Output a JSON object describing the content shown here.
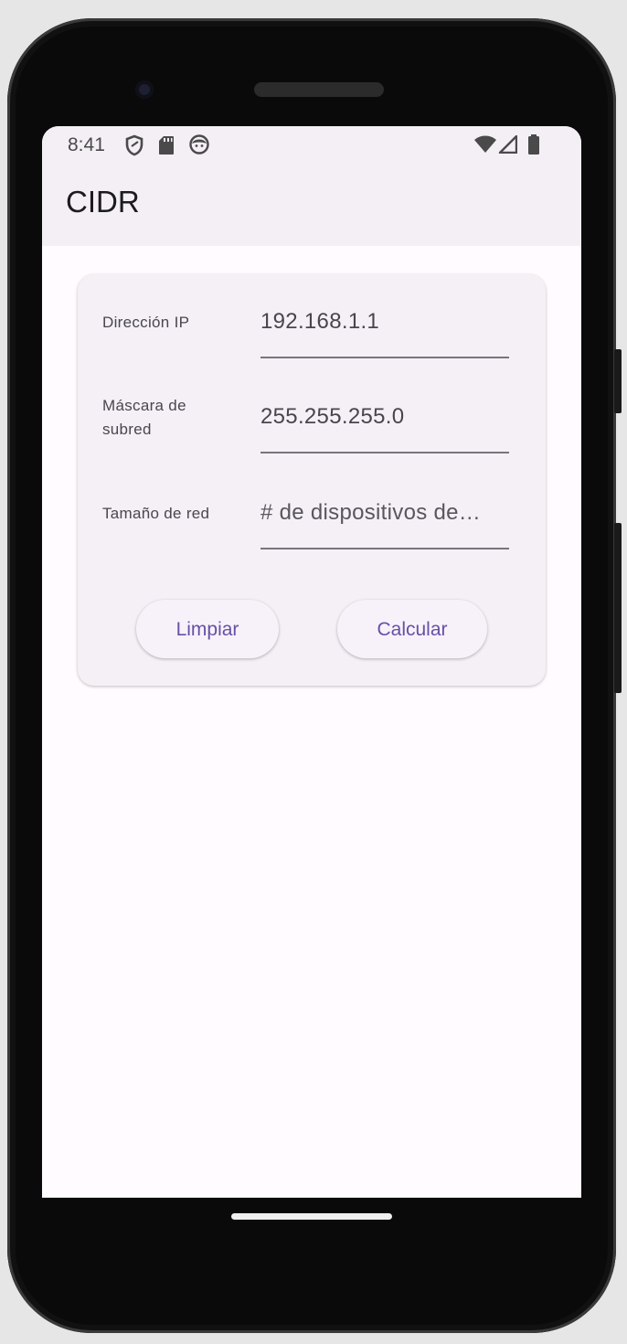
{
  "status_bar": {
    "time": "8:41",
    "left_icons": [
      "shield-icon",
      "sd-card-icon",
      "face-icon"
    ],
    "right_icons": [
      "wifi-icon",
      "signal-icon",
      "battery-icon"
    ]
  },
  "app_bar": {
    "title": "CIDR"
  },
  "form": {
    "ip_label": "Dirección IP",
    "ip_value": "192.168.1.1",
    "mask_label_line1": "Máscara de",
    "mask_label_line2": "subred",
    "mask_value": "255.255.255.0",
    "size_label": "Tamaño de red",
    "size_placeholder": "# de dispositivos de…"
  },
  "buttons": {
    "clear_label": "Limpiar",
    "calculate_label": "Calcular"
  },
  "colors": {
    "accent": "#6750a4",
    "surface": "#f4f0f6",
    "background": "#fffbfe",
    "app_bar": "#f3eff4"
  }
}
